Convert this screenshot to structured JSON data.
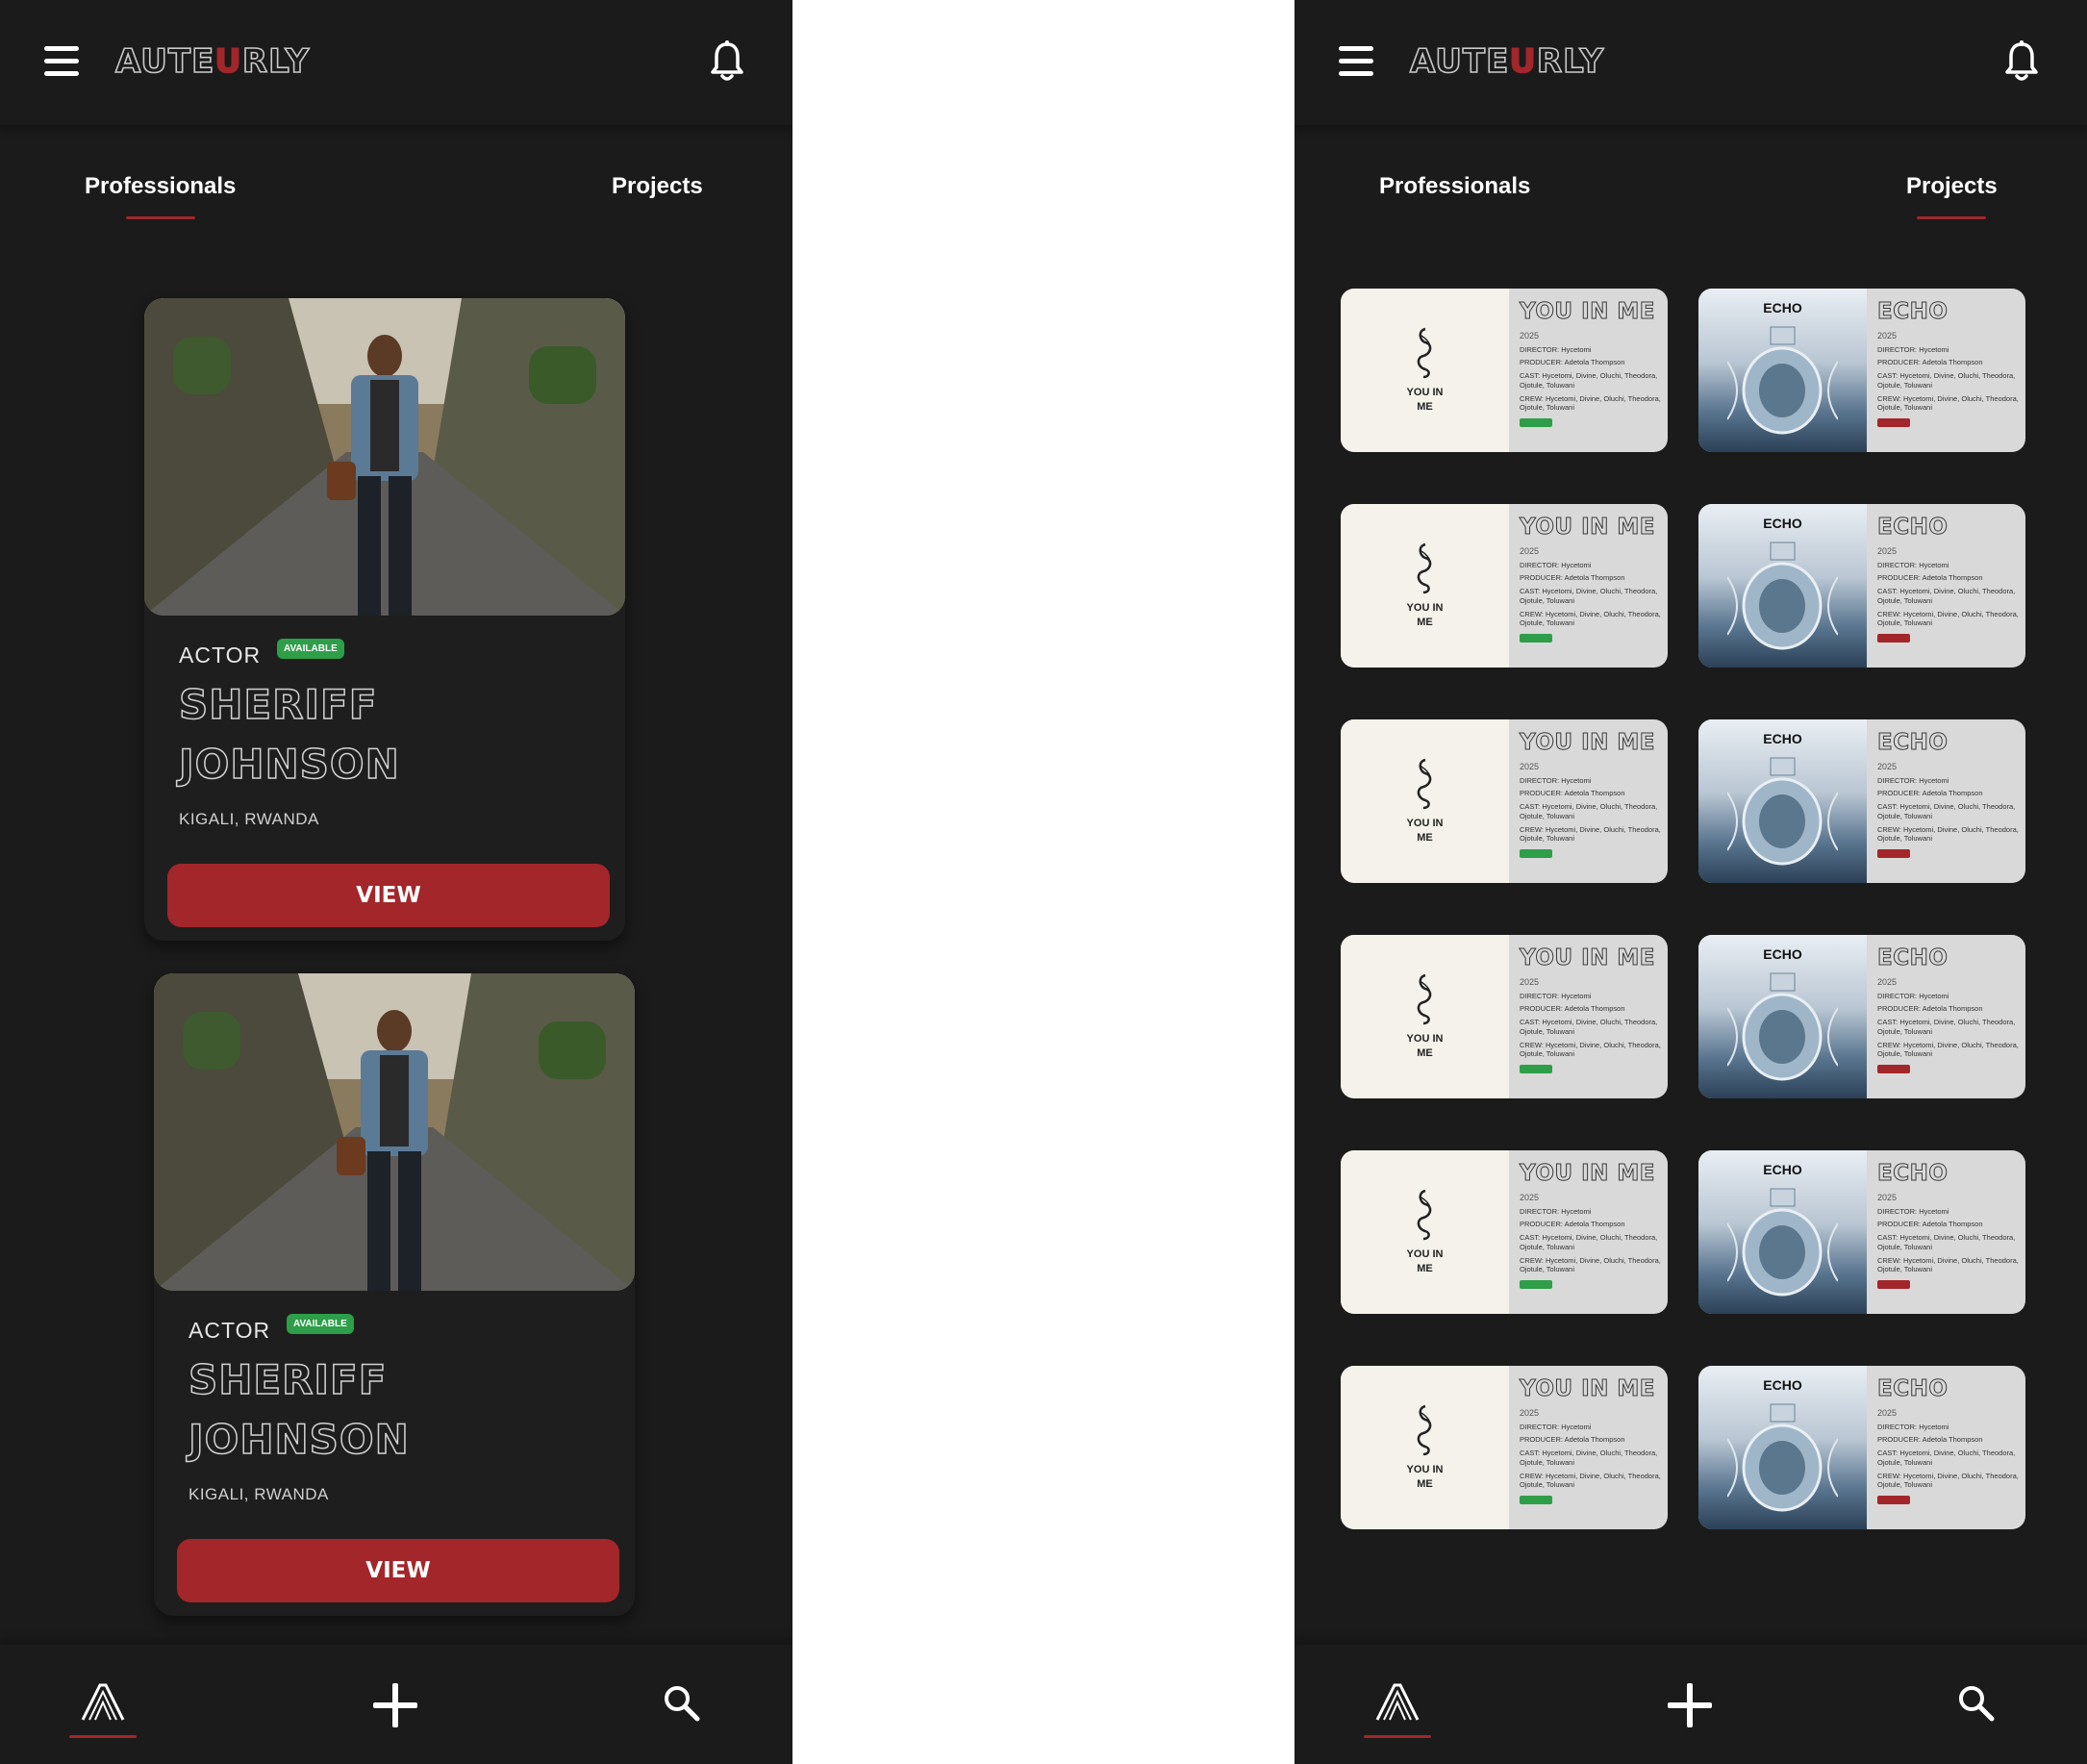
{
  "app": {
    "logo_prefix": "AUTE",
    "logo_accent": "U",
    "logo_suffix": "RLY"
  },
  "colors": {
    "background": "#1b1b1b",
    "accent": "#a3262a",
    "available": "#2e9e49",
    "text": "#ffffff"
  },
  "tabs": {
    "professionals": "Professionals",
    "projects": "Projects"
  },
  "left_screen": {
    "active_tab": "professionals",
    "cards": [
      {
        "role": "ACTOR",
        "badge": "AVAILABLE",
        "first_name": "SHERIFF",
        "last_name": "JOHNSON",
        "location": "KIGALI, RWANDA",
        "button": "VIEW"
      },
      {
        "role": "ACTOR",
        "badge": "AVAILABLE",
        "first_name": "SHERIFF",
        "last_name": "JOHNSON",
        "location": "KIGALI, RWANDA",
        "button": "VIEW"
      }
    ]
  },
  "right_screen": {
    "active_tab": "projects",
    "you_in_me": {
      "title": "YOU IN ME",
      "poster_line1": "YOU IN",
      "poster_line2": "ME",
      "year": "2025",
      "director": "DIRECTOR: Hycetomi",
      "producer": "PRODUCER: Adetola Thompson",
      "cast": "CAST: Hycetomi, Divine, Oluchi, Theodora, Ojotule, Toluwani",
      "crew": "CREW: Hycetomi, Divine, Oluchi, Theodora, Ojotule, Toluwani",
      "badge_color": "#2e9e49"
    },
    "echo": {
      "title": "ECHO",
      "poster_title": "ECHO",
      "year": "2025",
      "director": "DIRECTOR: Hycetomi",
      "producer": "PRODUCER: Adetola Thompson",
      "cast": "CAST: Hycetomi, Divine, Oluchi, Theodora, Ojotule, Toluwani",
      "crew": "CREW: Hycetomi, Divine, Oluchi, Theodora, Ojotule, Toluwani",
      "badge_color": "#a3262a"
    },
    "rows": 6
  },
  "icons": {
    "menu": "hamburger-icon",
    "notifications": "bell-icon",
    "home": "auteurly-a-icon",
    "add": "plus-icon",
    "search": "search-icon"
  }
}
